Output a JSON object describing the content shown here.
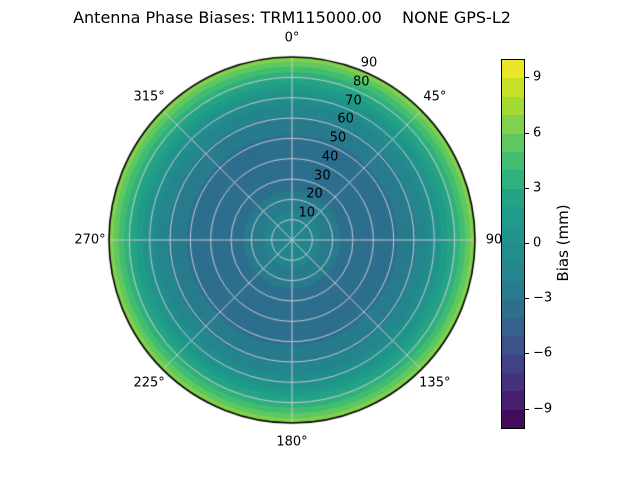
{
  "chart_data": {
    "type": "heatmap",
    "projection": "polar",
    "title": "Antenna Phase Biases: TRM115000.00    NONE GPS-L2",
    "theta_ticks": [
      {
        "angle_deg": 0,
        "label": "0°"
      },
      {
        "angle_deg": 45,
        "label": "45°"
      },
      {
        "angle_deg": 90,
        "label": "90"
      },
      {
        "angle_deg": 135,
        "label": "135°"
      },
      {
        "angle_deg": 180,
        "label": "180°"
      },
      {
        "angle_deg": 225,
        "label": "225°"
      },
      {
        "angle_deg": 270,
        "label": "270°"
      },
      {
        "angle_deg": 315,
        "label": "315°"
      }
    ],
    "r_ticks": [
      {
        "value": 10,
        "label": "10"
      },
      {
        "value": 20,
        "label": "20"
      },
      {
        "value": 30,
        "label": "30"
      },
      {
        "value": 40,
        "label": "40"
      },
      {
        "value": 50,
        "label": "50"
      },
      {
        "value": 60,
        "label": "60"
      },
      {
        "value": 70,
        "label": "70"
      },
      {
        "value": 80,
        "label": "80"
      },
      {
        "value": 90,
        "label": "90"
      }
    ],
    "r_max": 90,
    "r_label_angle_deg": 22.5,
    "grid": true,
    "radial_profile": {
      "zenith_deg": [
        0,
        5,
        15,
        25,
        35,
        45,
        52,
        60,
        65,
        68,
        71,
        74,
        77,
        80,
        83,
        86,
        88,
        90
      ],
      "bias_mm": [
        -0.8,
        -1.2,
        -2.1,
        -3.1,
        -3.5,
        -3.4,
        -3.0,
        -2.2,
        -1.4,
        -0.7,
        0.2,
        1.1,
        2.1,
        3.1,
        4.1,
        5.2,
        6.1,
        7.0
      ]
    },
    "colorbar": {
      "label": "Bias (mm)",
      "tick_values": [
        9,
        6,
        3,
        0,
        -3,
        -6,
        -9
      ],
      "vmin": -10,
      "vmax": 10,
      "n_bands": 20,
      "position": "right"
    },
    "colors": {
      "colormap": "viridis",
      "viridis_stops": [
        "#440154",
        "#482878",
        "#3e4a89",
        "#31688e",
        "#26828e",
        "#21918c",
        "#1f9e89",
        "#35b779",
        "#6ece58",
        "#b5de2b",
        "#fde725"
      ],
      "grid_line": "#c6c8d2",
      "outline": "#000000",
      "background": "#ffffff",
      "text": "#000000"
    }
  }
}
